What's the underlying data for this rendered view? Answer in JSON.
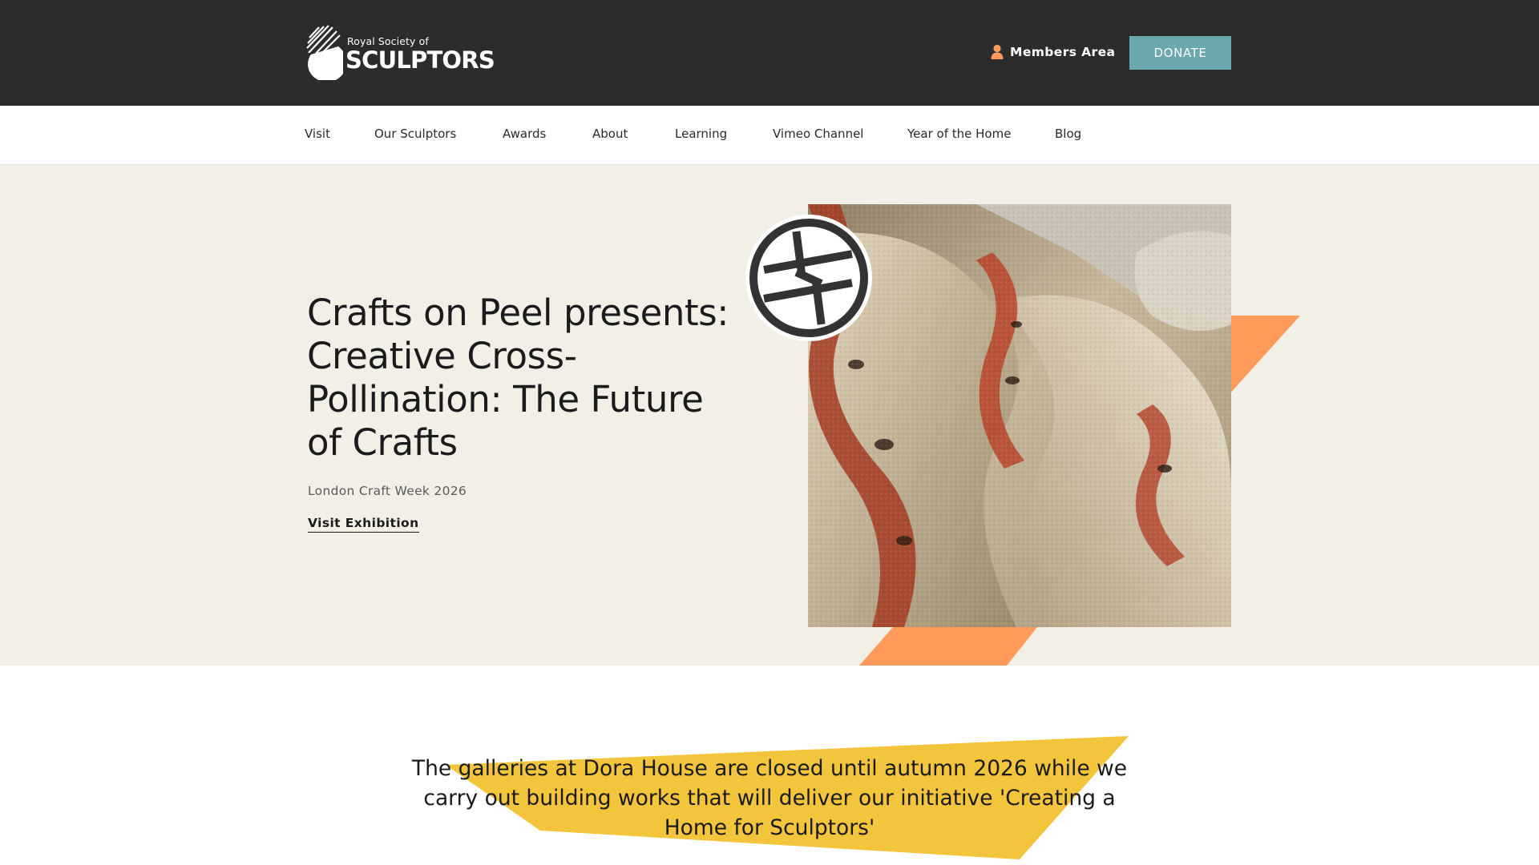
{
  "header": {
    "logo_small": "Royal Society of",
    "logo_big": "SCULPTORS",
    "members_label": "Members Area",
    "donate_label": "DONATE",
    "background_color": "#2c2c2c",
    "donate_color": "#6aa8ad",
    "members_icon": "user-icon"
  },
  "nav": {
    "items": [
      {
        "label": "Visit"
      },
      {
        "label": "Our Sculptors"
      },
      {
        "label": "Awards"
      },
      {
        "label": "About"
      },
      {
        "label": "Learning"
      },
      {
        "label": "Vimeo Channel"
      },
      {
        "label": "Year of the Home"
      },
      {
        "label": "Blog"
      }
    ]
  },
  "hero": {
    "title": "Crafts on Peel presents: Creative Cross-Pollination: The Future of Crafts",
    "subtitle": "London Craft Week 2026",
    "link_label": "Visit Exhibition",
    "background_color": "#f2f0e6",
    "accent_color": "#ff9a5a",
    "badge_icon": "crafts-on-peel-logo-icon",
    "image": "woven-metallic-textile-image"
  },
  "notice": {
    "text": "The galleries at Dora House are closed until autumn 2026 while we carry out building works that will deliver our initiative 'Creating a Home for Sculptors'",
    "highlight_color": "#f2c53d"
  }
}
